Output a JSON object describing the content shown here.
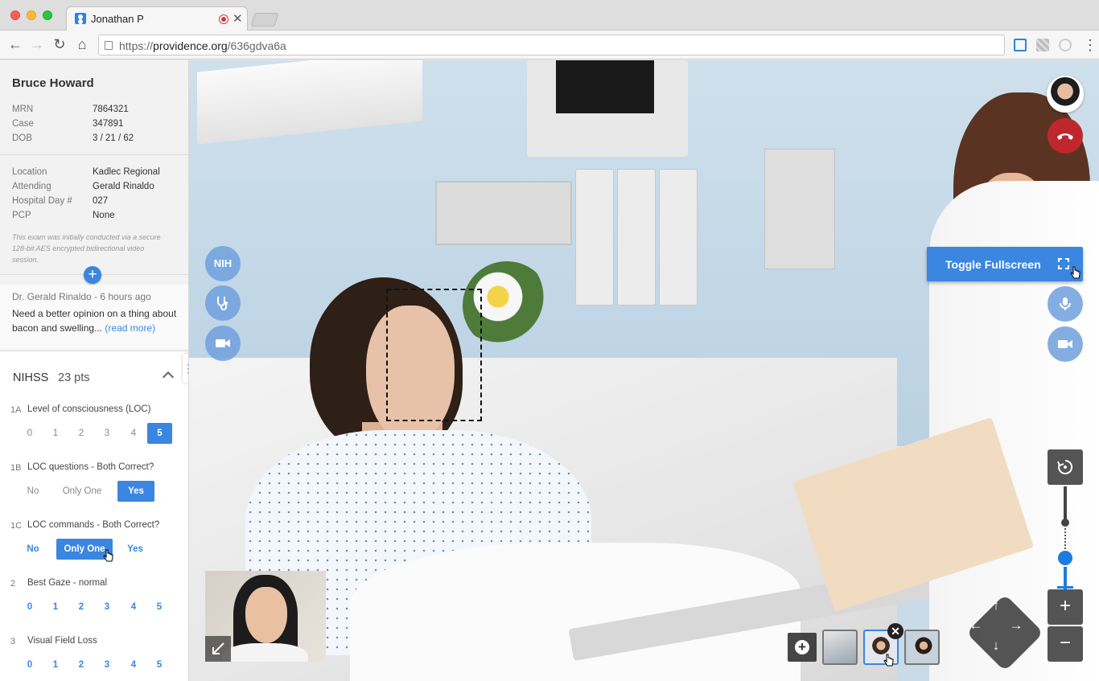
{
  "browser": {
    "tab_title": "Jonathan P",
    "tab_close": "✕",
    "url_scheme": "https://",
    "url_host": "providence.org",
    "url_path": "/636gdva6a",
    "back_label": "←",
    "forward_label": "→",
    "reload_label": "↻",
    "home_label": "⌂",
    "menu_label": "⋮"
  },
  "patient": {
    "name": "Bruce Howard",
    "ids": [
      {
        "label": "MRN",
        "value": "7864321"
      },
      {
        "label": "Case",
        "value": "347891"
      },
      {
        "label": "DOB",
        "value": "3 / 21 / 62"
      }
    ],
    "details": [
      {
        "label": "Location",
        "value": "Kadlec Regional"
      },
      {
        "label": "Attending",
        "value": "Gerald Rinaldo"
      },
      {
        "label": "Hospital Day #",
        "value": "027"
      },
      {
        "label": "PCP",
        "value": "None"
      }
    ],
    "disclaimer": "This exam was initially conducted via a secure 128-bit AES encrypted bidirectional video session."
  },
  "note": {
    "add_label": "+",
    "meta": "Dr. Gerald Rinaldo - 6 hours ago",
    "text": "Need a better opinion on a thing about bacon and swelling...",
    "link": "(read more)"
  },
  "nihss": {
    "title": "NIHSS",
    "points": "23 pts",
    "menu_label": "⋮",
    "questions": [
      {
        "num": "1A",
        "label": "Level of consciousness (LOC)",
        "options": [
          "0",
          "1",
          "2",
          "3",
          "4",
          "5"
        ],
        "selected": "5"
      },
      {
        "num": "1B",
        "label": "LOC questions - Both Correct?",
        "options": [
          "No",
          "Only One",
          "Yes"
        ],
        "selected": "Yes"
      },
      {
        "num": "1C",
        "label": "LOC commands - Both Correct?",
        "options": [
          "No",
          "Only One",
          "Yes"
        ],
        "selected": "Only One"
      },
      {
        "num": "2",
        "label": "Best Gaze - normal",
        "options": [
          "0",
          "1",
          "2",
          "3",
          "4",
          "5"
        ],
        "selected": null
      },
      {
        "num": "3",
        "label": "Visual Field Loss",
        "options": [
          "0",
          "1",
          "2",
          "3",
          "4",
          "5"
        ],
        "selected": null
      }
    ]
  },
  "call": {
    "nih_label": "NIH",
    "fullscreen_tooltip": "Toggle Fullscreen",
    "zoom_in_label": "+",
    "zoom_out_label": "−",
    "strip_add_label": "+",
    "thumb_close_label": "✕",
    "zoom_level": 0.25,
    "dpad": {
      "up": "↑",
      "down": "↓",
      "left": "←",
      "right": "→"
    }
  },
  "colors": {
    "accent": "#3a86e0",
    "hangup": "#c0272d",
    "panel_bg": "#f2f2f2"
  },
  "icons": [
    "user-icon",
    "record-icon",
    "stethoscope-icon",
    "video-camera-icon",
    "phone-hangup-icon",
    "fullscreen-icon",
    "microphone-icon",
    "reset-view-icon",
    "collapse-arrow-icon",
    "chevron-up-icon"
  ]
}
